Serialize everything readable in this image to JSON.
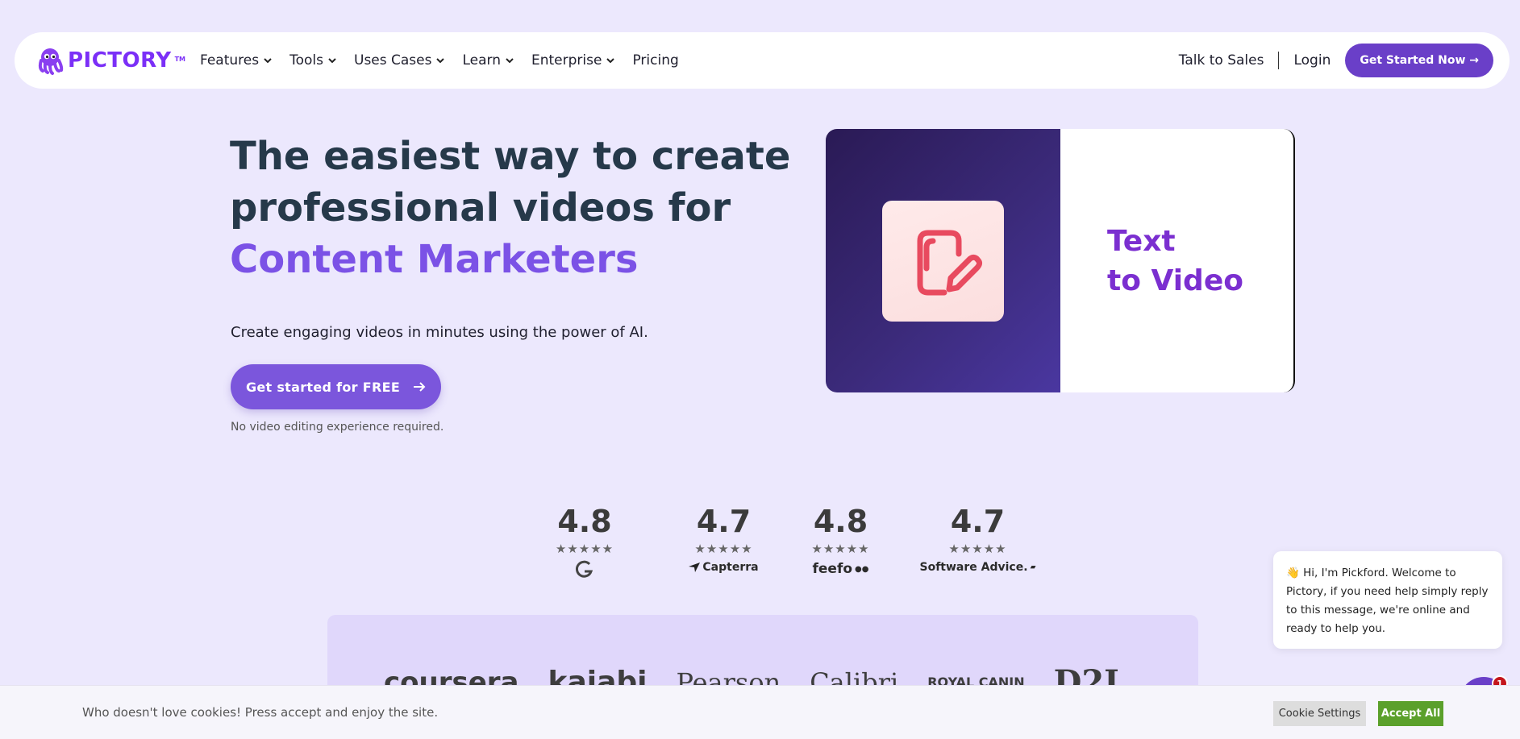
{
  "nav": {
    "logo_text": "PICTORY",
    "logo_tm": "TM",
    "items": [
      {
        "label": "Features",
        "has_dropdown": true
      },
      {
        "label": "Tools",
        "has_dropdown": true
      },
      {
        "label": "Uses Cases",
        "has_dropdown": true
      },
      {
        "label": "Learn",
        "has_dropdown": true
      },
      {
        "label": "Enterprise",
        "has_dropdown": true
      },
      {
        "label": "Pricing",
        "has_dropdown": false
      }
    ],
    "talk_to_sales": "Talk to Sales",
    "login": "Login",
    "cta": "Get Started Now →"
  },
  "hero": {
    "title_line1": "The easiest way to create",
    "title_line2": "professional videos for",
    "title_accent": "Content Marketers",
    "subtitle": "Create engaging videos in minutes using the power of AI.",
    "cta": "Get started for FREE",
    "note": "No video editing experience required.",
    "media_text": "Text\nto Video",
    "media_icon": "script-edit-icon"
  },
  "ratings": [
    {
      "score": "4.8",
      "stars": "★★★★★",
      "brand": "G2"
    },
    {
      "score": "4.7",
      "stars": "★★★★★",
      "brand": "Capterra"
    },
    {
      "score": "4.8",
      "stars": "★★★★★",
      "brand": "feefo"
    },
    {
      "score": "4.7",
      "stars": "★★★★★",
      "brand": "Software Advice."
    }
  ],
  "logos": [
    "coursera",
    "kajabi",
    "Pearson",
    "Calibri",
    "ROYAL CANIN",
    "D2L"
  ],
  "chat": {
    "message": "👋 Hi, I'm Pickford. Welcome to Pictory, if you need help simply reply to this message, we're online and ready to help you.",
    "badge_count": "1"
  },
  "cookie": {
    "text": "Who doesn't love cookies! Press accept and enjoy the site.",
    "settings_label": "Cookie Settings",
    "accept_label": "Accept All"
  },
  "colors": {
    "page_bg": "#ece8fd",
    "brand_purple": "#6a3fc8",
    "accent_purple": "#7b52e6",
    "accept_green": "#5ba02b"
  }
}
